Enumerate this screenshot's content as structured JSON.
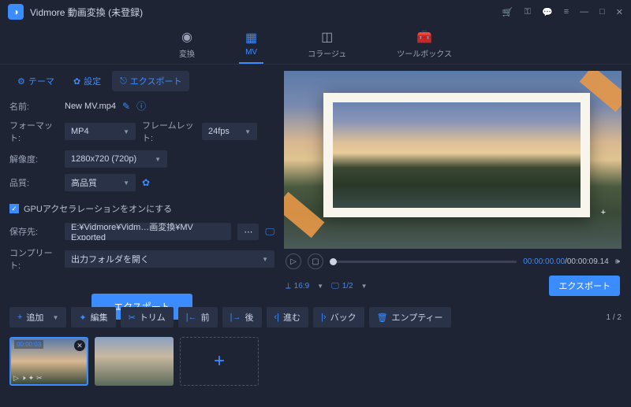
{
  "app": {
    "title": "Vidmore 動画変換 (未登録)"
  },
  "window_icons": [
    "cart",
    "key",
    "chat",
    "menu",
    "minimize",
    "maximize",
    "close"
  ],
  "nav": [
    {
      "label": "変換",
      "active": false
    },
    {
      "label": "MV",
      "active": true
    },
    {
      "label": "コラージュ",
      "active": false
    },
    {
      "label": "ツールボックス",
      "active": false
    }
  ],
  "subtabs": [
    {
      "label": "テーマ",
      "icon": "sliders"
    },
    {
      "label": "設定",
      "icon": "gear"
    },
    {
      "label": "エクスポート",
      "icon": "export",
      "active": true
    }
  ],
  "form": {
    "name_label": "名前:",
    "name_value": "New MV.mp4",
    "format_label": "フォーマット:",
    "format_value": "MP4",
    "framelet_label": "フレームレット:",
    "framelet_value": "24fps",
    "resolution_label": "解像度:",
    "resolution_value": "1280x720 (720p)",
    "quality_label": "品質:",
    "quality_value": "高品質",
    "gpu_label": "GPUアクセラレーションをオンにする",
    "gpu_checked": true,
    "saveto_label": "保存先:",
    "saveto_value": "E:¥Vidmore¥Vidm…画変換¥MV Exported",
    "complete_label": "コンプリート:",
    "complete_value": "出力フォルダを開く",
    "export_button": "エクスポート"
  },
  "preview": {
    "current_time": "00:00:00.00",
    "total_time": "00:00:09.14",
    "aspect": "16:9",
    "scale": "1/2",
    "export_button": "エクスポート"
  },
  "toolbar": [
    {
      "label": "追加",
      "icon": "+",
      "caret": true
    },
    {
      "label": "編集",
      "icon": "✦"
    },
    {
      "label": "トリム",
      "icon": "✂"
    },
    {
      "label": "前",
      "icon": "|←"
    },
    {
      "label": "後",
      "icon": "|→"
    },
    {
      "label": "進む",
      "icon": "‹|"
    },
    {
      "label": "バック",
      "icon": "|›"
    },
    {
      "label": "エンプティー",
      "icon": "🗑"
    }
  ],
  "page_indicator": "1 / 2",
  "clips": [
    {
      "duration": "00:00:03",
      "selected": true
    },
    {
      "duration": "",
      "selected": false
    }
  ]
}
